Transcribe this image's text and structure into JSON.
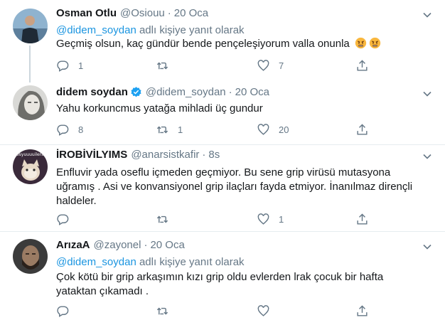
{
  "tweets": [
    {
      "name": "Osman Otlu",
      "handle": "@Osiouu",
      "dot": "·",
      "time": "20 Oca",
      "reply_mention": "@didem_soydan",
      "reply_suffix": " adlı kişiye yanıt olarak",
      "text": "Geçmiş olsun, kaç gündür bende pençeleşiyorum valla onunla",
      "emojis": [
        "angry-face-emoji",
        "angry-face-emoji"
      ],
      "replies": "1",
      "retweets": "",
      "likes": "7"
    },
    {
      "name": "didem soydan",
      "verified": true,
      "handle": "@didem_soydan",
      "dot": "·",
      "time": "20 Oca",
      "text": "Yahu korkuncmus yatağa mihladi üç gundur",
      "replies": "8",
      "retweets": "1",
      "likes": "20"
    },
    {
      "name": "İROBİVİLYIMS",
      "handle": "@anarsistkafir",
      "dot": "·",
      "time": "8s",
      "text": "Enfluvir yada oseflu içmeden geçmiyor. Bu sene grip virüsü mutasyona uğramış . Asi ve konvansiyonel grip ilaçları fayda etmiyor. İnanılmaz dirençli haldeler.",
      "replies": "",
      "retweets": "",
      "likes": "1"
    },
    {
      "name": "ArızaA",
      "handle": "@zayonel",
      "dot": "·",
      "time": "20 Oca",
      "reply_mention": "@didem_soydan",
      "reply_suffix": " adlı kişiye yanıt olarak",
      "text": "Çok kötü bir grip arkaşımın kızı grip oldu evlerden lrak çocuk bir hafta yataktan çıkamadı .",
      "replies": "",
      "retweets": "",
      "likes": ""
    }
  ],
  "avatar3_text": "osyuuuuilera",
  "colors": {
    "accent": "#1b95e0",
    "secondary_text": "#657786",
    "divider": "#e6ecf0",
    "thread_line": "#ccd6dd"
  }
}
